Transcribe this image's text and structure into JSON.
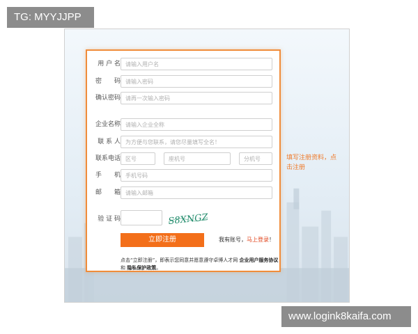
{
  "watermarks": {
    "top": "TG: MYYJJPP",
    "bottom": "www.logink8kaifa.com"
  },
  "form": {
    "username": {
      "label": "用 户 名",
      "placeholder": "请输入用户名"
    },
    "password": {
      "label": "密　　码",
      "placeholder": "请输入密码"
    },
    "confirm_password": {
      "label": "确认密码",
      "placeholder": "请再一次输入密码"
    },
    "company": {
      "label": "企业名称",
      "placeholder": "请输入企业全称"
    },
    "contact": {
      "label": "联 系 人",
      "placeholder": "为方便与您联系，请您尽量填写全名！"
    },
    "phone": {
      "label": "联系电话",
      "area_placeholder": "区号",
      "number_placeholder": "座机号",
      "ext_placeholder": "分机号"
    },
    "mobile": {
      "label": "手　　机",
      "placeholder": "手机号码"
    },
    "email": {
      "label": "邮　　箱",
      "placeholder": "请输入邮箱"
    },
    "captcha": {
      "label": "验 证 码",
      "image_text": "S8XNGZ"
    },
    "submit_label": "立即注册",
    "login_prompt": "我有账号，",
    "login_link": "马上登录",
    "login_suffix": "！",
    "terms": {
      "prefix": "点击“立即注册”，即表示您同意并愿意遵守卓博人才网",
      "agreement": "企业用户服务协议",
      "and": "和",
      "privacy": "隐私保护政策",
      "suffix": "。"
    }
  },
  "side_note": "填写注册资料，点击注册",
  "colors": {
    "accent": "#f36f1a",
    "border": "#f08c3a",
    "captcha_text": "#1f8a6a"
  }
}
